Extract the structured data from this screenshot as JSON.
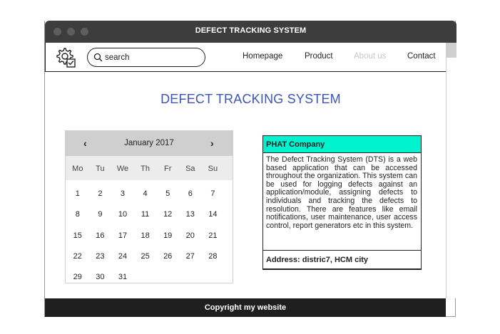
{
  "window": {
    "title": "DEFECT TRACKING SYSTEM"
  },
  "navbar": {
    "search_placeholder": "search",
    "links": [
      {
        "label": "Homepage",
        "state": "normal"
      },
      {
        "label": "Product",
        "state": "normal"
      },
      {
        "label": "About us",
        "state": "disabled"
      },
      {
        "label": "Contact",
        "state": "normal"
      }
    ]
  },
  "main": {
    "title": "DEFECT TRACKING SYSTEM"
  },
  "calendar": {
    "month_label": "January 2017",
    "prev": "‹",
    "next": "›",
    "weekdays": [
      "Mo",
      "Tu",
      "We",
      "Th",
      "Fr",
      "Sa",
      "Su"
    ],
    "weeks": [
      [
        "1",
        "2",
        "3",
        "4",
        "5",
        "6",
        "7"
      ],
      [
        "8",
        "9",
        "10",
        "11",
        "12",
        "13",
        "14"
      ],
      [
        "15",
        "16",
        "17",
        "18",
        "19",
        "20",
        "21"
      ],
      [
        "22",
        "23",
        "24",
        "25",
        "26",
        "27",
        "28"
      ],
      [
        "29",
        "30",
        "31",
        "",
        "",
        "",
        ""
      ]
    ]
  },
  "company": {
    "name": "PHAT Company",
    "description": "The Defect Tracking System (DTS) is a web based application that can be accessed throughout the organization. This system can be used for logging defects against an application/module, assigning defects to individuals and tracking the defects to resolution. There are features like email notifications, user maintenance, user access control, report generators etc in this system.",
    "address": "Address: distric7, HCM city"
  },
  "footer": {
    "text": "Copyright my website"
  },
  "colors": {
    "accent_title": "#3b55b8",
    "company_header": "#00f3cf",
    "titlebar": "#3d3d3d",
    "footer": "#1f1f1f"
  },
  "icons": {
    "logo": "gear-settings-icon",
    "search": "search-icon",
    "resize": "resize-handle-icon"
  }
}
